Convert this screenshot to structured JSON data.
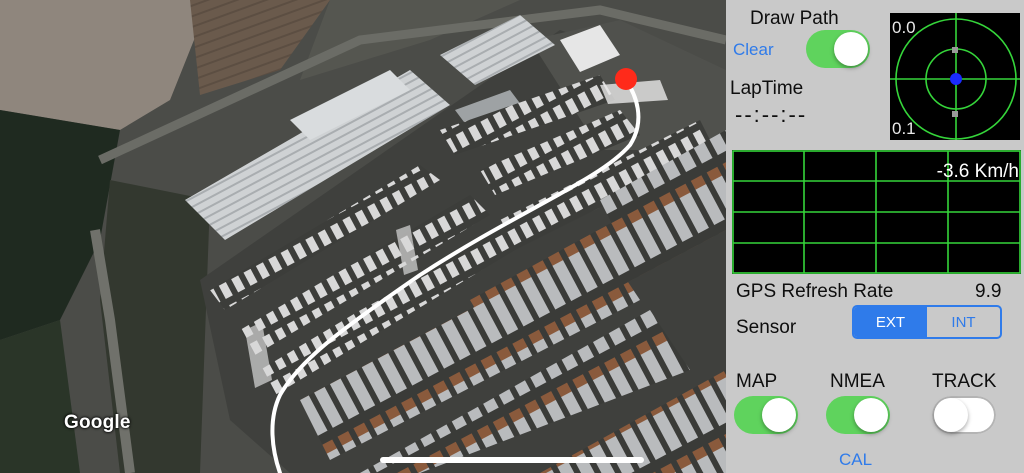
{
  "map": {
    "attribution": "Google",
    "marker_color": "#ff2a1a",
    "path_color": "#ffffff"
  },
  "panel": {
    "draw_path_label": "Draw Path",
    "draw_path_on": true,
    "clear_label": "Clear",
    "laptime_label": "LapTime",
    "laptime_value": "--:--:--",
    "radar": {
      "top_label": "0.0",
      "bottom_label": "0.1"
    },
    "speed_label": "-3.6 Km/h",
    "gps_rate_label": "GPS Refresh Rate",
    "gps_rate_value": "9.9",
    "sensor_label": "Sensor",
    "sensor_options": [
      "EXT",
      "INT"
    ],
    "sensor_selected": "EXT",
    "map_label": "MAP",
    "map_on": true,
    "nmea_label": "NMEA",
    "nmea_on": true,
    "track_label": "TRACK",
    "track_on": false,
    "cal_label": "CAL",
    "accent_color": "#2f7bea",
    "grid_color": "#35d53a"
  }
}
